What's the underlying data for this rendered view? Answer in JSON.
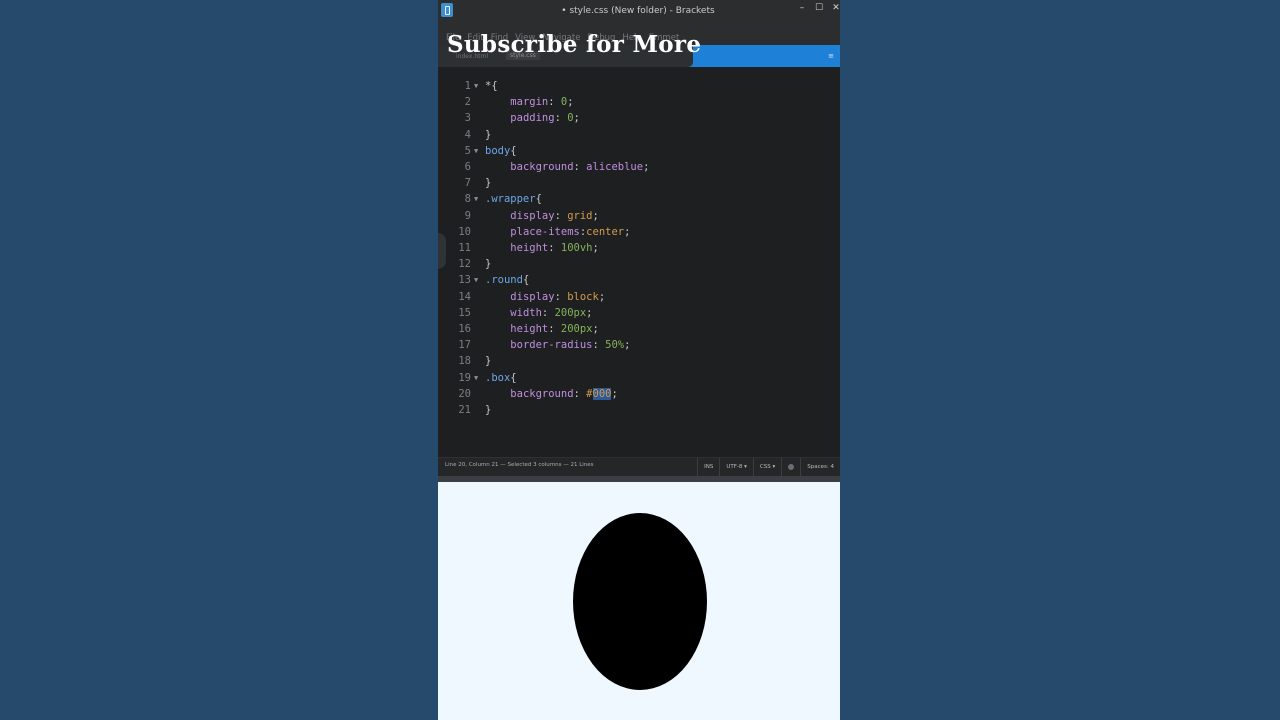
{
  "overlay": {
    "text": "Subscribe for More"
  },
  "window": {
    "title": "• style.css (New folder) - Brackets",
    "minimize": "–",
    "maximize": "☐",
    "close": "✕"
  },
  "menu": [
    "File",
    "Edit",
    "Find",
    "View",
    "Navigate",
    "Debug",
    "Help",
    "Emmet"
  ],
  "tabs": [
    {
      "label": "index.html"
    },
    {
      "label": "style.css"
    }
  ],
  "editor": {
    "lines": [
      {
        "n": "1",
        "fold": true,
        "parts": [
          [
            "brace",
            "*{"
          ]
        ]
      },
      {
        "n": "2",
        "fold": false,
        "parts": [
          [
            "plain",
            "    "
          ],
          [
            "prop",
            "margin"
          ],
          [
            "brace",
            ": "
          ],
          [
            "num",
            "0"
          ],
          [
            "brace",
            ";"
          ]
        ]
      },
      {
        "n": "3",
        "fold": false,
        "parts": [
          [
            "plain",
            "    "
          ],
          [
            "prop",
            "padding"
          ],
          [
            "brace",
            ": "
          ],
          [
            "num",
            "0"
          ],
          [
            "brace",
            ";"
          ]
        ]
      },
      {
        "n": "4",
        "fold": false,
        "parts": [
          [
            "brace",
            "}"
          ]
        ]
      },
      {
        "n": "5",
        "fold": true,
        "parts": [
          [
            "sel",
            "body"
          ],
          [
            "brace",
            "{"
          ]
        ]
      },
      {
        "n": "6",
        "fold": false,
        "parts": [
          [
            "plain",
            "    "
          ],
          [
            "prop",
            "background"
          ],
          [
            "brace",
            ": "
          ],
          [
            "prop",
            "aliceblue"
          ],
          [
            "brace",
            ";"
          ]
        ]
      },
      {
        "n": "7",
        "fold": false,
        "parts": [
          [
            "brace",
            "}"
          ]
        ]
      },
      {
        "n": "8",
        "fold": true,
        "parts": [
          [
            "sel",
            ".wrapper"
          ],
          [
            "brace",
            "{"
          ]
        ]
      },
      {
        "n": "9",
        "fold": false,
        "parts": [
          [
            "plain",
            "    "
          ],
          [
            "prop",
            "display"
          ],
          [
            "brace",
            ": "
          ],
          [
            "val",
            "grid"
          ],
          [
            "brace",
            ";"
          ]
        ]
      },
      {
        "n": "10",
        "fold": false,
        "parts": [
          [
            "plain",
            "    "
          ],
          [
            "prop",
            "place-items"
          ],
          [
            "brace",
            ":"
          ],
          [
            "val",
            "center"
          ],
          [
            "brace",
            ";"
          ]
        ]
      },
      {
        "n": "11",
        "fold": false,
        "parts": [
          [
            "plain",
            "    "
          ],
          [
            "prop",
            "height"
          ],
          [
            "brace",
            ": "
          ],
          [
            "num",
            "100vh"
          ],
          [
            "brace",
            ";"
          ]
        ]
      },
      {
        "n": "12",
        "fold": false,
        "parts": [
          [
            "brace",
            "}"
          ]
        ]
      },
      {
        "n": "13",
        "fold": true,
        "parts": [
          [
            "sel",
            ".round"
          ],
          [
            "brace",
            "{"
          ]
        ]
      },
      {
        "n": "14",
        "fold": false,
        "parts": [
          [
            "plain",
            "    "
          ],
          [
            "prop",
            "display"
          ],
          [
            "brace",
            ": "
          ],
          [
            "val",
            "block"
          ],
          [
            "brace",
            ";"
          ]
        ]
      },
      {
        "n": "15",
        "fold": false,
        "parts": [
          [
            "plain",
            "    "
          ],
          [
            "prop",
            "width"
          ],
          [
            "brace",
            ": "
          ],
          [
            "num",
            "200px"
          ],
          [
            "brace",
            ";"
          ]
        ]
      },
      {
        "n": "16",
        "fold": false,
        "parts": [
          [
            "plain",
            "    "
          ],
          [
            "prop",
            "height"
          ],
          [
            "brace",
            ": "
          ],
          [
            "num",
            "200px"
          ],
          [
            "brace",
            ";"
          ]
        ]
      },
      {
        "n": "17",
        "fold": false,
        "parts": [
          [
            "plain",
            "    "
          ],
          [
            "prop",
            "border-radius"
          ],
          [
            "brace",
            ": "
          ],
          [
            "num",
            "50%"
          ],
          [
            "brace",
            ";"
          ]
        ]
      },
      {
        "n": "18",
        "fold": false,
        "parts": [
          [
            "brace",
            "}"
          ]
        ]
      },
      {
        "n": "19",
        "fold": true,
        "parts": [
          [
            "sel",
            ".box"
          ],
          [
            "brace",
            "{"
          ]
        ]
      },
      {
        "n": "20",
        "fold": false,
        "parts": [
          [
            "plain",
            "    "
          ],
          [
            "prop",
            "background"
          ],
          [
            "brace",
            ": "
          ],
          [
            "hash",
            "#"
          ],
          [
            "hl",
            "000"
          ],
          [
            "brace",
            ";"
          ]
        ]
      },
      {
        "n": "21",
        "fold": false,
        "parts": [
          [
            "brace",
            "}"
          ]
        ]
      }
    ]
  },
  "status": {
    "position": "Line 20, Column 21 — Selected 3 columns — 21 Lines",
    "mode": "INS",
    "encoding": "UTF-8 ▾",
    "language": "CSS ▾",
    "spaces": "Spaces: 4"
  },
  "preview": {
    "box_color": "#000000",
    "background": "#f0f8ff"
  }
}
